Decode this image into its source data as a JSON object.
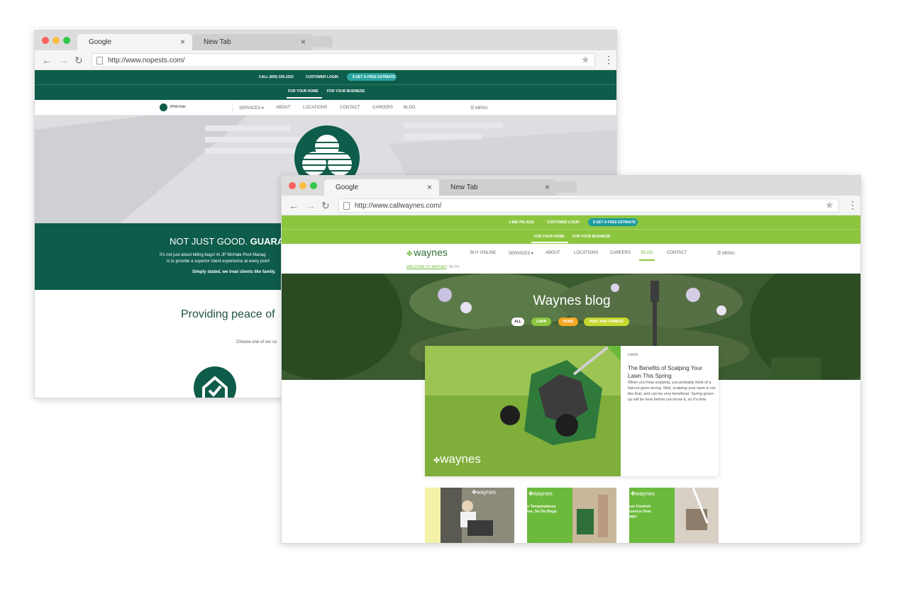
{
  "window1": {
    "tabs": [
      {
        "label": "Google",
        "close": "×"
      },
      {
        "label": "New Tab",
        "close": "×"
      }
    ],
    "url": "http://www.nopests.com/",
    "topbar": {
      "call": "CALL (855) 226-2253",
      "login": "CUSTOMER LOGIN",
      "estimate": "$ GET A FREE ESTIMATE",
      "for_home": "FOR YOUR HOME",
      "for_business": "FOR YOUR BUSINESS"
    },
    "nav": {
      "logo_text": "JPMcHale",
      "services": "SERVICES ▾",
      "about": "ABOUT",
      "locations": "LOCATIONS",
      "contact": "CONTACT",
      "careers": "CAREERS",
      "blog": "BLOG",
      "menu": "☰ MENU"
    },
    "band": {
      "heading_regular": "NOT JUST GOOD.",
      "heading_bold": "GUARANT",
      "line1": "It's not just about killing bugs! At JP McHale Pest Manag",
      "line2": "is to provide a superior client experience at every point",
      "line3": "Simply stated, we treat clients like family."
    },
    "peace": "Providing peace of",
    "choose": "Choose one of our co"
  },
  "window2": {
    "tabs": [
      {
        "label": "Google",
        "close": "×"
      },
      {
        "label": "New Tab",
        "close": "×"
      }
    ],
    "url": "http://www.callwaynes.com/",
    "topbar": {
      "phone": "1-888-765-4118",
      "login": "CUSTOMER LOGIN",
      "estimate": "$ GET A FREE ESTIMATE",
      "for_home": "FOR YOUR HOME",
      "for_business": "FOR YOUR BUSINESS"
    },
    "nav": {
      "logo": "waynes",
      "buy_online": "BUY ONLINE",
      "services": "SERVICES ▾",
      "about": "ABOUT",
      "locations": "LOCATIONS",
      "careers": "CAREERS",
      "blog": "BLOG",
      "contact": "CONTACT",
      "menu": "☰ MENU"
    },
    "breadcrumb": {
      "home": "WELCOME TO WAYNES",
      "sep": "/",
      "current": "BLOG"
    },
    "hero": {
      "title": "Waynes blog",
      "pills": [
        "ALL",
        "LAWN",
        "HOME",
        "PEST AND TERMITE"
      ]
    },
    "featured": {
      "tag": "LAWN",
      "title": "The Benefits of Scalping Your Lawn This Spring",
      "body": "When you hear scalping, you probably think of a haircut gone wrong. Well, scalping your lawn is not like that, and can be very beneficial. Spring green-up will be here before you know it, so it's time",
      "image_logo": "waynes"
    },
    "thumbs": [
      {
        "logo": "waynes",
        "text": ""
      },
      {
        "logo": "waynes",
        "text": "s Temperatures\nise, So Do Bugs"
      },
      {
        "logo": "waynes",
        "text": "est Control:\ncience Over\nagic"
      }
    ]
  },
  "colors": {
    "jp_green": "#0e5c4a",
    "waynes_green": "#8cc63f",
    "teal_button": "#2aa5a0"
  }
}
